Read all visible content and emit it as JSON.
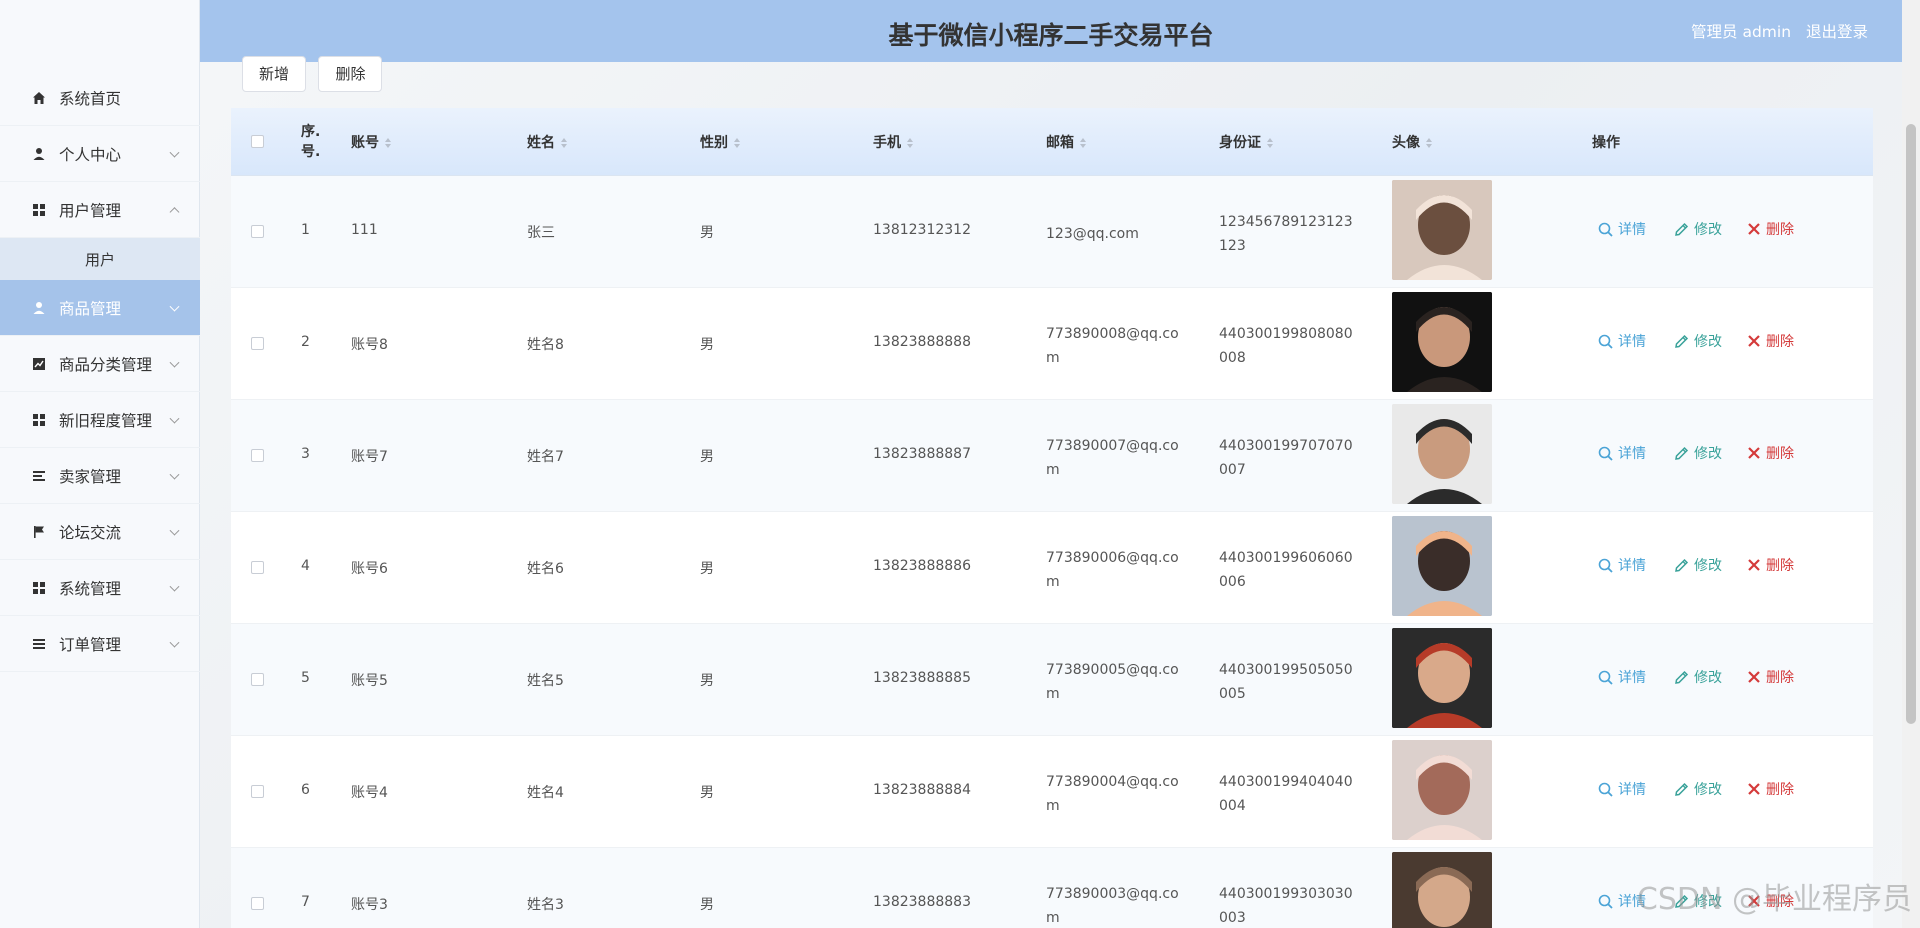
{
  "header": {
    "title": "基于微信小程序二手交易平台",
    "user_label": "管理员 admin",
    "logout": "退出登录"
  },
  "sidebar": {
    "items": [
      {
        "label": "系统首页",
        "icon": "home-icon"
      },
      {
        "label": "个人中心",
        "icon": "person-icon"
      },
      {
        "label": "用户管理",
        "icon": "grid-icon"
      },
      {
        "label": "商品管理",
        "icon": "person-icon"
      },
      {
        "label": "商品分类管理",
        "icon": "chart-icon"
      },
      {
        "label": "新旧程度管理",
        "icon": "grid-icon"
      },
      {
        "label": "卖家管理",
        "icon": "list-icon"
      },
      {
        "label": "论坛交流",
        "icon": "flag-icon"
      },
      {
        "label": "系统管理",
        "icon": "grid-icon"
      },
      {
        "label": "订单管理",
        "icon": "list-icon"
      }
    ],
    "submenu_user": "用户"
  },
  "toolbar": {
    "add": "新增",
    "delete": "删除"
  },
  "table": {
    "columns": [
      "序号",
      "账号",
      "姓名",
      "性别",
      "手机",
      "邮箱",
      "身份证",
      "头像",
      "操作"
    ],
    "index_header_line1": "序.",
    "index_header_line2": "号.",
    "actions": {
      "view": "详情",
      "edit": "修改",
      "delete": "删除"
    },
    "rows": [
      {
        "idx": "1",
        "account": "111",
        "name": "张三",
        "gender": "男",
        "phone": "13812312312",
        "email": "123@qq.com",
        "idcard": "123456789123123123"
      },
      {
        "idx": "2",
        "account": "账号8",
        "name": "姓名8",
        "gender": "男",
        "phone": "13823888888",
        "email": "773890008@qq.com",
        "idcard": "440300199808080008"
      },
      {
        "idx": "3",
        "account": "账号7",
        "name": "姓名7",
        "gender": "男",
        "phone": "13823888887",
        "email": "773890007@qq.com",
        "idcard": "440300199707070007"
      },
      {
        "idx": "4",
        "account": "账号6",
        "name": "姓名6",
        "gender": "男",
        "phone": "13823888886",
        "email": "773890006@qq.com",
        "idcard": "440300199606060006"
      },
      {
        "idx": "5",
        "account": "账号5",
        "name": "姓名5",
        "gender": "男",
        "phone": "13823888885",
        "email": "773890005@qq.com",
        "idcard": "440300199505050005"
      },
      {
        "idx": "6",
        "account": "账号4",
        "name": "姓名4",
        "gender": "男",
        "phone": "13823888884",
        "email": "773890004@qq.com",
        "idcard": "440300199404040004"
      },
      {
        "idx": "7",
        "account": "账号3",
        "name": "姓名3",
        "gender": "男",
        "phone": "13823888883",
        "email": "773890003@qq.com",
        "idcard": "440300199303030003"
      }
    ]
  },
  "watermark": "CSDN @毕业程序员",
  "colors": {
    "header_bg": "#a4c4ed",
    "active_menu": "#a5c3ea",
    "view": "#4aa3d6",
    "edit": "#3aa29a",
    "delete": "#d43a3a"
  }
}
